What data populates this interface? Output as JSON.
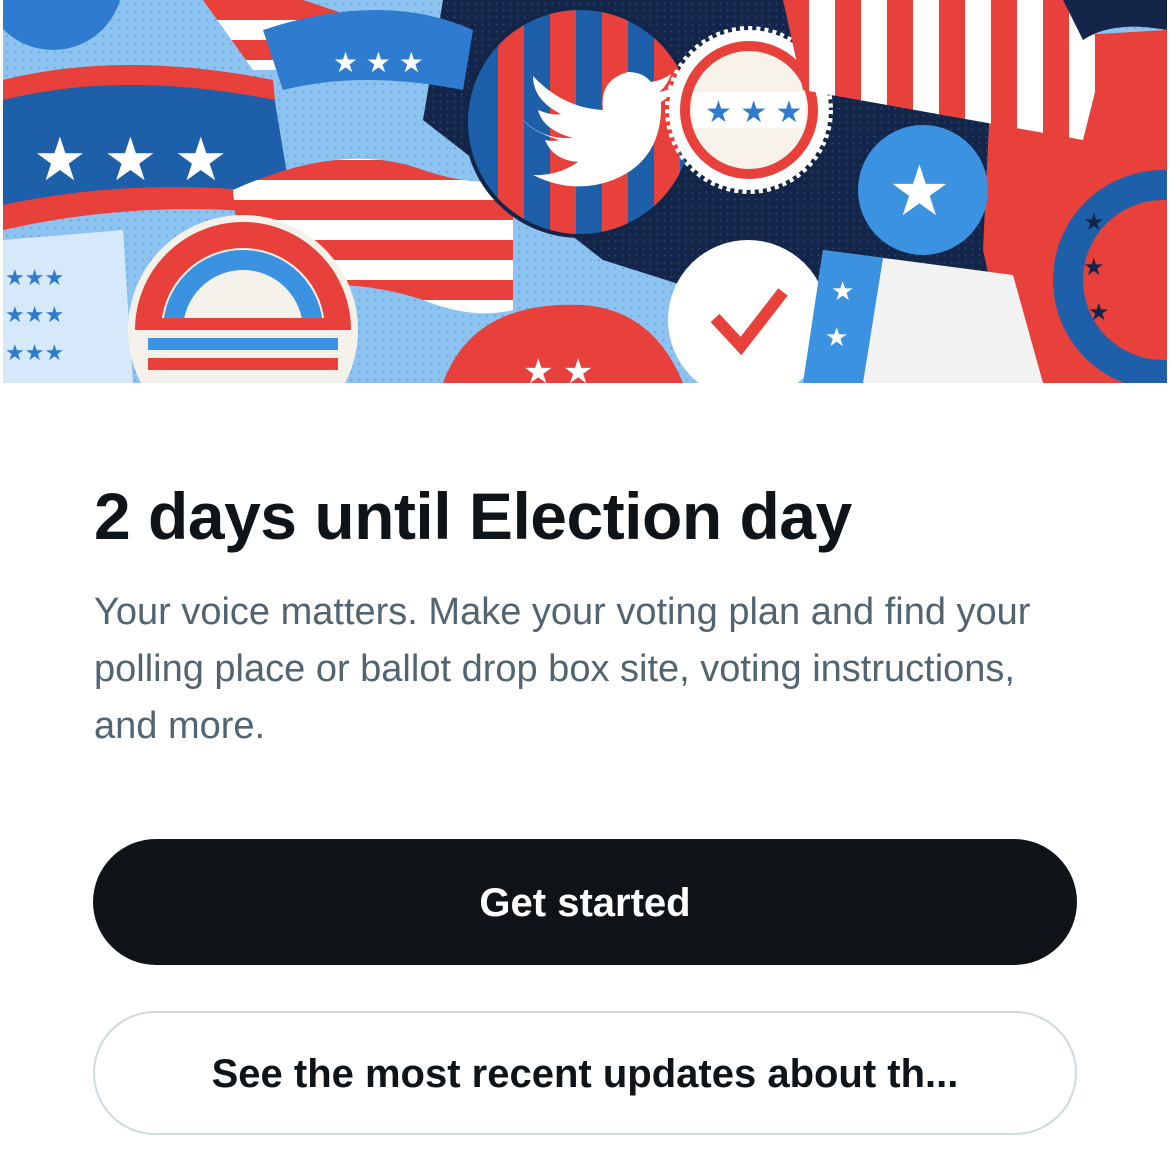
{
  "hero": {
    "image_name": "election-stickers-banner",
    "colors": {
      "red": "#e8403a",
      "blue": "#1d5fa8",
      "light_blue": "#8dc3f0",
      "navy": "#13264a",
      "white": "#ffffff",
      "twitter_blue": "#1d9bf0"
    }
  },
  "card": {
    "title": "2 days until Election day",
    "description": "Your voice matters. Make your voting plan and find your polling place or ballot drop box site, voting instructions, and more."
  },
  "actions": {
    "primary_label": "Get started",
    "secondary_label": "See the most recent updates about th..."
  },
  "theme": {
    "text_primary": "#0f1419",
    "text_secondary": "#536471",
    "button_dark": "#0f1419",
    "border": "#cfd9de"
  }
}
